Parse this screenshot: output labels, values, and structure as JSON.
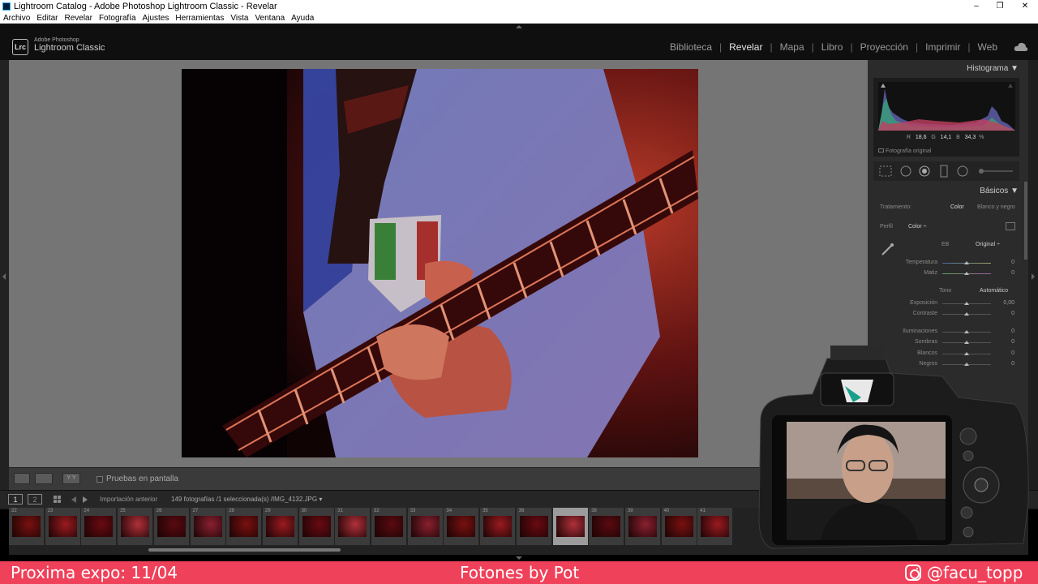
{
  "window": {
    "title": "Lightroom Catalog - Adobe Photoshop Lightroom Classic - Revelar",
    "controls": [
      "–",
      "❐",
      "✕"
    ]
  },
  "menu": [
    "Archivo",
    "Editar",
    "Revelar",
    "Fotografía",
    "Ajustes",
    "Herramientas",
    "Vista",
    "Ventana",
    "Ayuda"
  ],
  "brand": {
    "badge": "Lrc",
    "small": "Adobe Photoshop",
    "big": "Lightroom Classic"
  },
  "modules": [
    {
      "label": "Biblioteca",
      "active": false
    },
    {
      "label": "Revelar",
      "active": true
    },
    {
      "label": "Mapa",
      "active": false
    },
    {
      "label": "Libro",
      "active": false
    },
    {
      "label": "Proyección",
      "active": false
    },
    {
      "label": "Imprimir",
      "active": false
    },
    {
      "label": "Web",
      "active": false
    }
  ],
  "toolbar": {
    "soft_proof_label": "Pruebas en pantalla",
    "view_yy": "Y Y"
  },
  "histogram": {
    "title": "Histograma",
    "r_label": "R",
    "r": "18,6",
    "g_label": "G",
    "g": "14,1",
    "b_label": "B",
    "b": "34,3",
    "pct": "%",
    "original_label": "Fotografía original"
  },
  "basic": {
    "title": "Básicos",
    "treatment_label": "Tratamiento:",
    "treatment_color": "Color",
    "treatment_bw": "Blanco y negro",
    "profile_label": "Perfil",
    "profile_value": "Color ÷",
    "wb_label": "EB",
    "wb_value": "Original ÷",
    "tone_label": "Tono",
    "auto_label": "Automático",
    "controls": [
      {
        "label": "Temperatura",
        "value": "0"
      },
      {
        "label": "Matiz",
        "value": "0"
      },
      {
        "label": "Exposición",
        "value": "0,00"
      },
      {
        "label": "Contraste",
        "value": "0"
      },
      {
        "label": "Iluminaciones",
        "value": "0"
      },
      {
        "label": "Sombras",
        "value": "0"
      },
      {
        "label": "Blancos",
        "value": "0"
      },
      {
        "label": "Negros",
        "value": "0"
      }
    ]
  },
  "filmstrip": {
    "page1": "1",
    "page2": "2",
    "source": "Importación anterior",
    "count": "149 fotografías /1 seleccionada(s) /IMG_4132.JPG ▾",
    "numbers": [
      "22",
      "23",
      "24",
      "25",
      "26",
      "27",
      "28",
      "29",
      "30",
      "31",
      "32",
      "33",
      "34",
      "35",
      "36",
      "37",
      "38",
      "39",
      "40",
      "41"
    ],
    "selected_index": 15
  },
  "banner": {
    "left": "Proxima expo: 11/04",
    "center": "Fotones by Pot",
    "right": "@facu_topp"
  }
}
